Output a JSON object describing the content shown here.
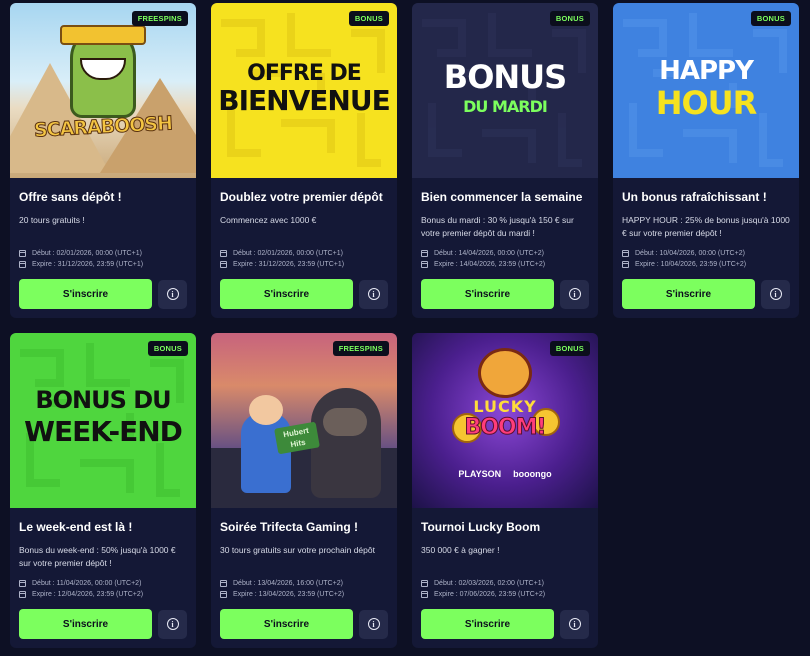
{
  "promotions": [
    {
      "badge": "FREESPINS",
      "art_text": "SCARABOOSH",
      "title": "Offre sans dépôt !",
      "desc": "20 tours gratuits !",
      "start": "Début : 02/01/2026, 00:00 (UTC+1)",
      "expire": "Expire : 31/12/2026, 23:59 (UTC+1)",
      "cta": "S'inscrire"
    },
    {
      "badge": "BONUS",
      "art_line1": "OFFRE DE",
      "art_line2": "BIENVENUE",
      "title": "Doublez votre premier dépôt",
      "desc": "Commencez avec 1000 €",
      "start": "Début : 02/01/2026, 00:00 (UTC+1)",
      "expire": "Expire : 31/12/2026, 23:59 (UTC+1)",
      "cta": "S'inscrire"
    },
    {
      "badge": "BONUS",
      "art_line1": "BONUS",
      "art_line2": "DU MARDI",
      "title": "Bien commencer la semaine",
      "desc": "Bonus du mardi : 30 % jusqu'à 150 € sur votre premier dépôt du mardi !",
      "start": "Début : 14/04/2026, 00:00 (UTC+2)",
      "expire": "Expire : 14/04/2026, 23:59 (UTC+2)",
      "cta": "S'inscrire"
    },
    {
      "badge": "BONUS",
      "art_line1": "HAPPY",
      "art_line2": "HOUR",
      "title": "Un bonus rafraîchissant !",
      "desc": "HAPPY HOUR : 25% de bonus jusqu'à 1000 € sur votre premier dépôt !",
      "start": "Début : 10/04/2026, 00:00 (UTC+2)",
      "expire": "Expire : 10/04/2026, 23:59 (UTC+2)",
      "cta": "S'inscrire"
    },
    {
      "badge": "BONUS",
      "art_line1": "BONUS DU",
      "art_line2": "WEEK-END",
      "title": "Le week-end est là !",
      "desc": "Bonus du week-end : 50% jusqu'à 1000 € sur votre premier dépôt !",
      "start": "Début : 11/04/2026, 00:00 (UTC+2)",
      "expire": "Expire : 12/04/2026, 23:59 (UTC+2)",
      "cta": "S'inscrire"
    },
    {
      "badge": "FREESPINS",
      "art_text": "Hubert Hits",
      "title": "Soirée Trifecta Gaming !",
      "desc": "30 tours gratuits sur votre prochain dépôt",
      "start": "Début : 13/04/2026, 16:00 (UTC+2)",
      "expire": "Expire : 13/04/2026, 23:59 (UTC+2)",
      "cta": "S'inscrire"
    },
    {
      "badge": "BONUS",
      "art_line1": "LUCKY",
      "art_line2": "BOOM!",
      "art_brand1": "PLAYSON",
      "art_brand2": "booongo",
      "title": "Tournoi Lucky Boom",
      "desc": "350 000 € à gagner !",
      "start": "Début : 02/03/2026, 02:00 (UTC+1)",
      "expire": "Expire : 07/06/2026, 23:59 (UTC+2)",
      "cta": "S'inscrire"
    }
  ],
  "colors": {
    "accent": "#7cff5e",
    "card": "#141836",
    "background": "#0d1024"
  }
}
